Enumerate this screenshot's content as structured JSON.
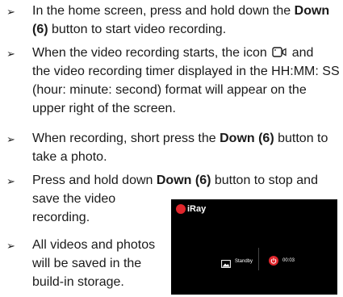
{
  "instructions": [
    {
      "lines": [
        [
          {
            "text": "In the home screen, press and hold down the "
          },
          {
            "text": "Down",
            "bold": true
          }
        ],
        [
          {
            "text": "(6)",
            "bold": true
          },
          {
            "text": " button to start video recording."
          }
        ]
      ]
    },
    {
      "lines": [
        [
          {
            "text": "When the video recording starts, the icon "
          },
          {
            "icon": "video-record-icon"
          },
          {
            "text": " and"
          }
        ],
        [
          {
            "text": "the video recording timer displayed in the HH:MM: SS"
          }
        ],
        [
          {
            "text": "(hour: minute: second) format will appear on the"
          }
        ],
        [
          {
            "text": "upper right of the screen."
          }
        ]
      ]
    },
    {
      "lines": [
        [
          {
            "text": "When recording, short press the "
          },
          {
            "text": "Down (6)",
            "bold": true
          },
          {
            "text": " button to"
          }
        ],
        [
          {
            "text": "take a photo."
          }
        ]
      ]
    },
    {
      "lines": [
        [
          {
            "text": "Press and hold down "
          },
          {
            "text": "Down (6)",
            "bold": true
          },
          {
            "text": " button to stop and"
          }
        ],
        [
          {
            "text": "save the video"
          }
        ],
        [
          {
            "text": "recording."
          }
        ]
      ]
    },
    {
      "lines": [
        [
          {
            "text": "All videos and photos"
          }
        ],
        [
          {
            "text": "will be saved in the"
          }
        ],
        [
          {
            "text": "build-in storage."
          }
        ]
      ]
    }
  ],
  "bullet_symbol": "➢",
  "screen": {
    "brand": "iRay",
    "standby_label": "Standby",
    "timer_value": "00:03",
    "accent_color": "#e0262c",
    "background_color": "#000000",
    "standby_icon": "camera-icon",
    "timer_icon": "power-icon"
  }
}
